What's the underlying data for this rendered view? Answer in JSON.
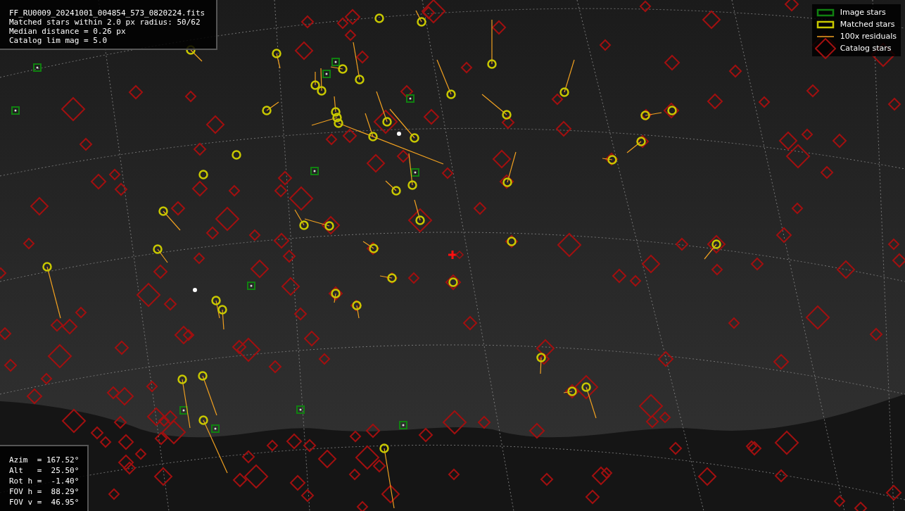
{
  "image_info": {
    "lines": [
      "FF_RU0009_20241001_004854_573_0820224.fits",
      "Matched stars within 2.0 px radius: 50/62",
      "Median distance = 0.26 px",
      "Catalog lim mag = 5.0"
    ]
  },
  "legend": {
    "items": [
      {
        "kind": "image",
        "label": "Image stars"
      },
      {
        "kind": "matched",
        "label": "Matched stars"
      },
      {
        "kind": "residual",
        "label": "100x residuals"
      },
      {
        "kind": "catalog",
        "label": "Catalog stars"
      }
    ]
  },
  "pointing": {
    "lines": [
      "Azim  = 167.52°",
      "Alt   =  25.50°",
      "Rot h =  -1.40°",
      "FOV h =  88.29°",
      "FOV v =  46.95°"
    ]
  }
}
